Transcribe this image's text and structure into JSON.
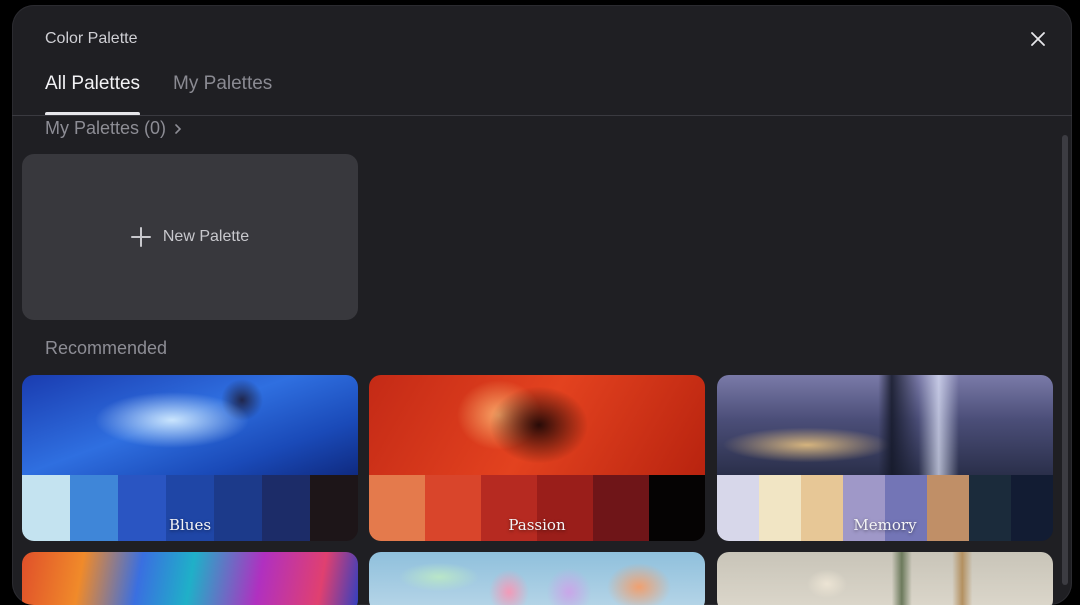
{
  "modal": {
    "title": "Color Palette",
    "close_icon": "close-icon"
  },
  "tabs": [
    {
      "label": "All Palettes",
      "active": true
    },
    {
      "label": "My Palettes",
      "active": false
    }
  ],
  "my_palettes": {
    "heading": "My Palettes (0)",
    "new_palette_label": "New Palette"
  },
  "recommended": {
    "heading": "Recommended",
    "cards": [
      {
        "name": "Blues",
        "swatches": [
          "#c4e3f0",
          "#3f86d8",
          "#2a55c2",
          "#1f46a6",
          "#1c3a8a",
          "#1c2c68",
          "#1d1518"
        ]
      },
      {
        "name": "Passion",
        "swatches": [
          "#e47a4c",
          "#d9452b",
          "#b62a21",
          "#9a1e1a",
          "#6f1518",
          "#050303"
        ]
      },
      {
        "name": "Memory",
        "swatches": [
          "#d7d7ea",
          "#f1e5c4",
          "#e7c796",
          "#9f98c8",
          "#7375b6",
          "#c08f67",
          "#1b2b3b",
          "#121c33"
        ]
      }
    ]
  },
  "colors": {
    "modal_bg": "#1f1f23",
    "tab_active": "#f2f2f5",
    "tab_inactive": "#8a8a92",
    "new_palette_bg": "#38383d"
  }
}
